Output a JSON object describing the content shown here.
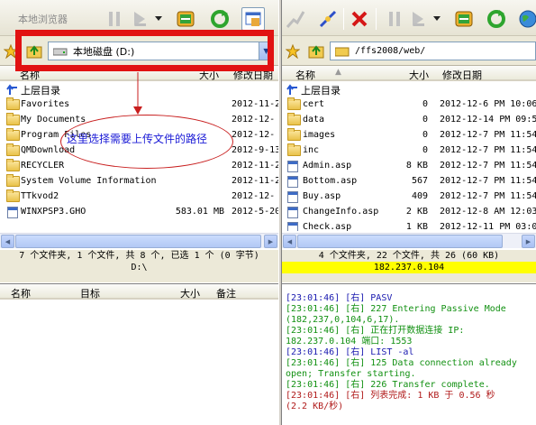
{
  "left": {
    "toolbar_title": "本地浏览器",
    "address": "本地磁盘 (D:)",
    "columns": {
      "name": "名称",
      "size": "大小",
      "date": "修改日期"
    },
    "up_label": "上层目录",
    "rows": [
      {
        "name": "Favorites",
        "size": "",
        "date": "2012-11-2"
      },
      {
        "name": "My Documents",
        "size": "",
        "date": "2012-12-"
      },
      {
        "name": "Program Files",
        "size": "",
        "date": "2012-12-"
      },
      {
        "name": "QMDownload",
        "size": "",
        "date": "2012-9-13"
      },
      {
        "name": "RECYCLER",
        "size": "",
        "date": "2012-11-2"
      },
      {
        "name": "System Volume Information",
        "size": "",
        "date": "2012-11-2"
      },
      {
        "name": "TTkvod2",
        "size": "",
        "date": "2012-12-"
      },
      {
        "name": "WINXPSP3.GHO",
        "size": "583.01 MB",
        "date": "2012-5-20"
      }
    ],
    "status_line1": "7 个文件夹, 1 个文件, 共 8 个, 已选 1 个 (0 字节)",
    "status_line2": "D:\\"
  },
  "right": {
    "address": "/ffs2008/web/",
    "columns": {
      "name": "名称",
      "size": "大小",
      "date": "修改日期"
    },
    "up_label": "上层目录",
    "rows": [
      {
        "name": "cert",
        "size": "0",
        "date": "2012-12-6 PM 10:06"
      },
      {
        "name": "data",
        "size": "0",
        "date": "2012-12-14 PM 09:5"
      },
      {
        "name": "images",
        "size": "0",
        "date": "2012-12-7 PM 11:54"
      },
      {
        "name": "inc",
        "size": "0",
        "date": "2012-12-7 PM 11:54"
      },
      {
        "name": "Admin.asp",
        "size": "8 KB",
        "date": "2012-12-7 PM 11:54"
      },
      {
        "name": "Bottom.asp",
        "size": "567",
        "date": "2012-12-7 PM 11:54"
      },
      {
        "name": "Buy.asp",
        "size": "409",
        "date": "2012-12-7 PM 11:54"
      },
      {
        "name": "ChangeInfo.asp",
        "size": "2 KB",
        "date": "2012-12-8 AM 12:03"
      },
      {
        "name": "Check.asp",
        "size": "1 KB",
        "date": "2012-12-11 PM 03:0"
      }
    ],
    "status_line1": "4 个文件夹, 22 个文件, 共 26 (60 KB)",
    "status_line2": "182.237.0.104",
    "status_highlight": "#ffff00"
  },
  "queue": {
    "columns": {
      "name": "名称",
      "target": "目标",
      "size": "大小",
      "note": "备注"
    }
  },
  "log": [
    {
      "text": "[23:01:46] [右] PASV",
      "color": "b"
    },
    {
      "text": "[23:01:46] [右] 227 Entering Passive Mode",
      "color": "g"
    },
    {
      "text": "(182,237,0,104,6,17).",
      "color": "g"
    },
    {
      "text": "[23:01:46] [右] 正在打开数据连接 IP:",
      "color": "g"
    },
    {
      "text": "182.237.0.104 端口: 1553",
      "color": "g"
    },
    {
      "text": "[23:01:46] [右] LIST -al",
      "color": "b"
    },
    {
      "text": "[23:01:46] [右] 125 Data connection already",
      "color": "g"
    },
    {
      "text": "open; Transfer starting.",
      "color": "g"
    },
    {
      "text": "[23:01:46] [右] 226 Transfer complete.",
      "color": "g"
    },
    {
      "text": "[23:01:46] [右] 列表完成: 1 KB 于 0.56 秒",
      "color": "r"
    },
    {
      "text": "(2.2 KB/秒)",
      "color": "r"
    }
  ],
  "annotation": {
    "text": "这里选择需要上传文件的路径",
    "frame_color": "#e11212"
  },
  "icons": [
    "bookmark-star-icon",
    "up-folder-icon",
    "pause-icon",
    "play-icon",
    "transfer-icon",
    "refresh-icon",
    "window-icon",
    "connect-icon",
    "disconnect-icon",
    "stop-icon",
    "globe-icon",
    "drive-icon",
    "dropdown-arrow-icon"
  ]
}
